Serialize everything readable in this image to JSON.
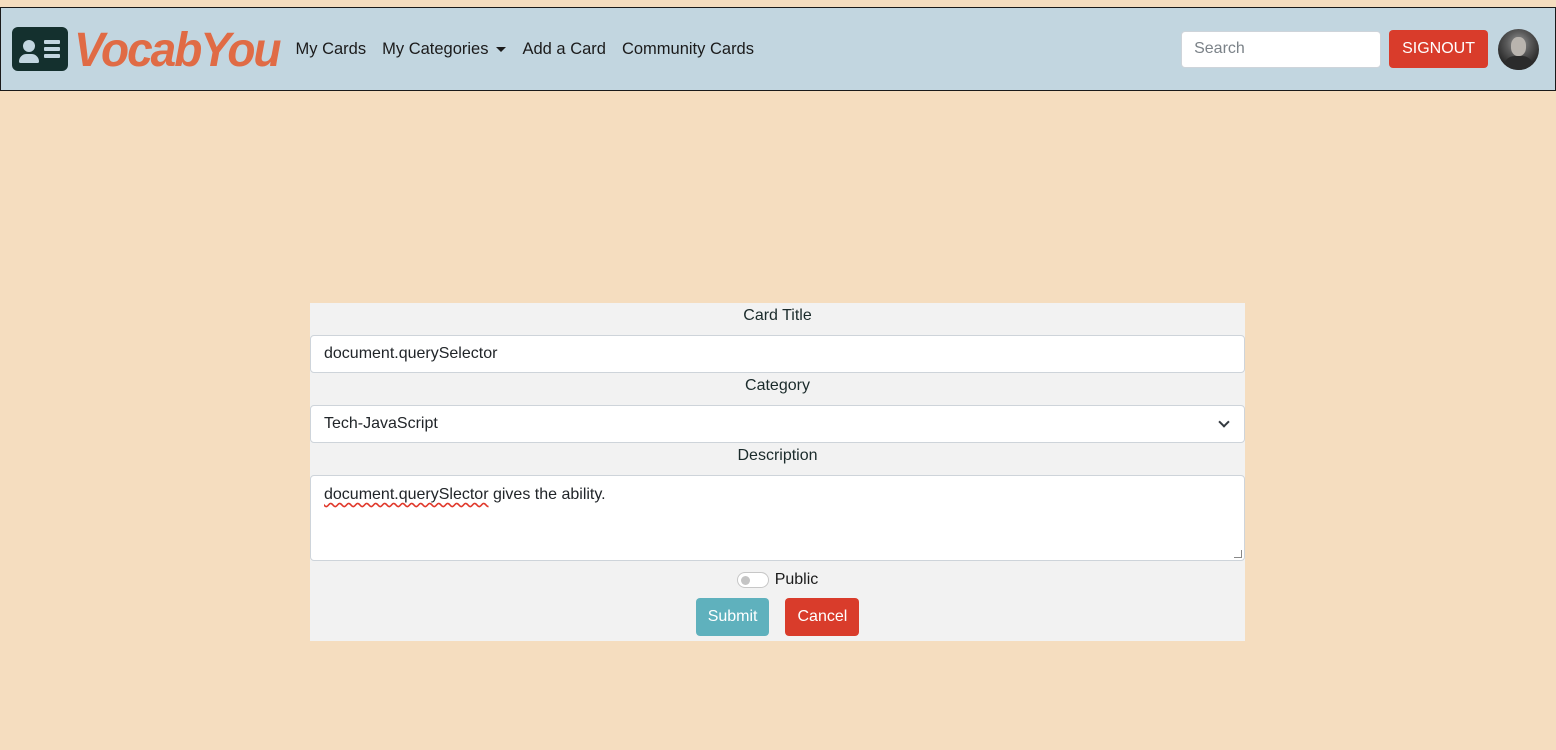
{
  "navbar": {
    "brand": "VocabYou",
    "links": [
      "My Cards",
      "My Categories",
      "Add a Card",
      "Community Cards"
    ],
    "search_placeholder": "Search",
    "signout_label": "SIGNOUT"
  },
  "form": {
    "title_label": "Card Title",
    "title_value": "document.querySelector",
    "category_label": "Category",
    "category_value": "Tech-JavaScript",
    "description_label": "Description",
    "description_value_word": "document.querySlector",
    "description_value_rest": " gives the ability.",
    "public_label": "Public",
    "public_checked": false,
    "submit_label": "Submit",
    "cancel_label": "Cancel"
  },
  "colors": {
    "page_bg": "#f5ddbf",
    "navbar_bg": "#c2d6e0",
    "brand": "#e06b45",
    "danger": "#d93c2b",
    "submit": "#5fb1bd"
  }
}
